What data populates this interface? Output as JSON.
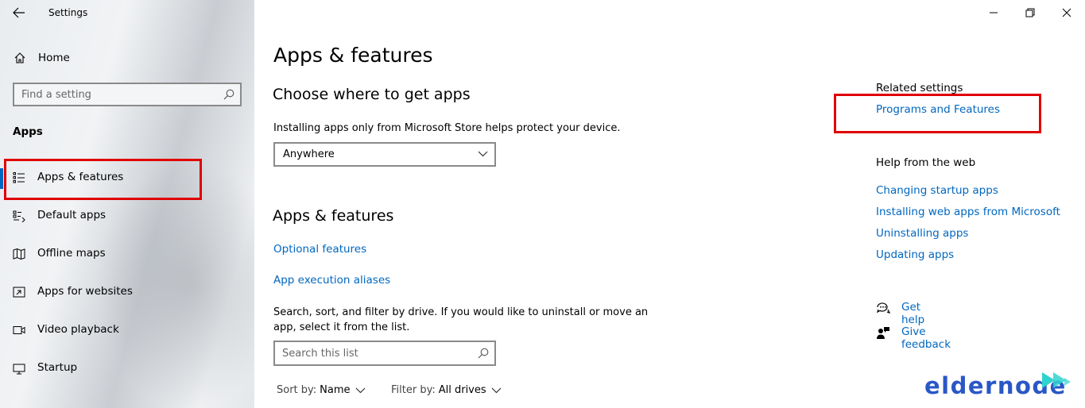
{
  "window": {
    "title": "Settings"
  },
  "sidebar": {
    "home_label": "Home",
    "search_placeholder": "Find a setting",
    "section_label": "Apps",
    "items": [
      {
        "label": "Apps & features",
        "icon": "list-icon",
        "active": true
      },
      {
        "label": "Default apps",
        "icon": "default-apps-icon"
      },
      {
        "label": "Offline maps",
        "icon": "map-icon"
      },
      {
        "label": "Apps for websites",
        "icon": "web-app-icon"
      },
      {
        "label": "Video playback",
        "icon": "video-icon"
      },
      {
        "label": "Startup",
        "icon": "startup-icon"
      }
    ]
  },
  "main": {
    "title": "Apps & features",
    "choose": {
      "heading": "Choose where to get apps",
      "description": "Installing apps only from Microsoft Store helps protect your device.",
      "dropdown_value": "Anywhere"
    },
    "features": {
      "heading": "Apps & features",
      "links": [
        "Optional features",
        "App execution aliases"
      ],
      "description_line1": "Search, sort, and filter by drive. If you would like to uninstall or move an",
      "description_line2": "app, select it from the list.",
      "search_placeholder": "Search this list",
      "sort_label": "Sort by:",
      "sort_value": "Name",
      "filter_label": "Filter by:",
      "filter_value": "All drives"
    }
  },
  "right": {
    "related_title": "Related settings",
    "related_link": "Programs and Features",
    "web_title": "Help from the web",
    "web_links": [
      "Changing startup apps",
      "Installing web apps from Microsoft",
      "Uninstalling apps",
      "Updating apps"
    ],
    "get_help": "Get help",
    "give_feedback": "Give feedback"
  },
  "logo": {
    "text": "eldernode"
  },
  "colors": {
    "accent": "#0067c0",
    "highlight": "#e00000",
    "logo": "#2a57c6",
    "logo_arrow": "#2ed3cf"
  }
}
